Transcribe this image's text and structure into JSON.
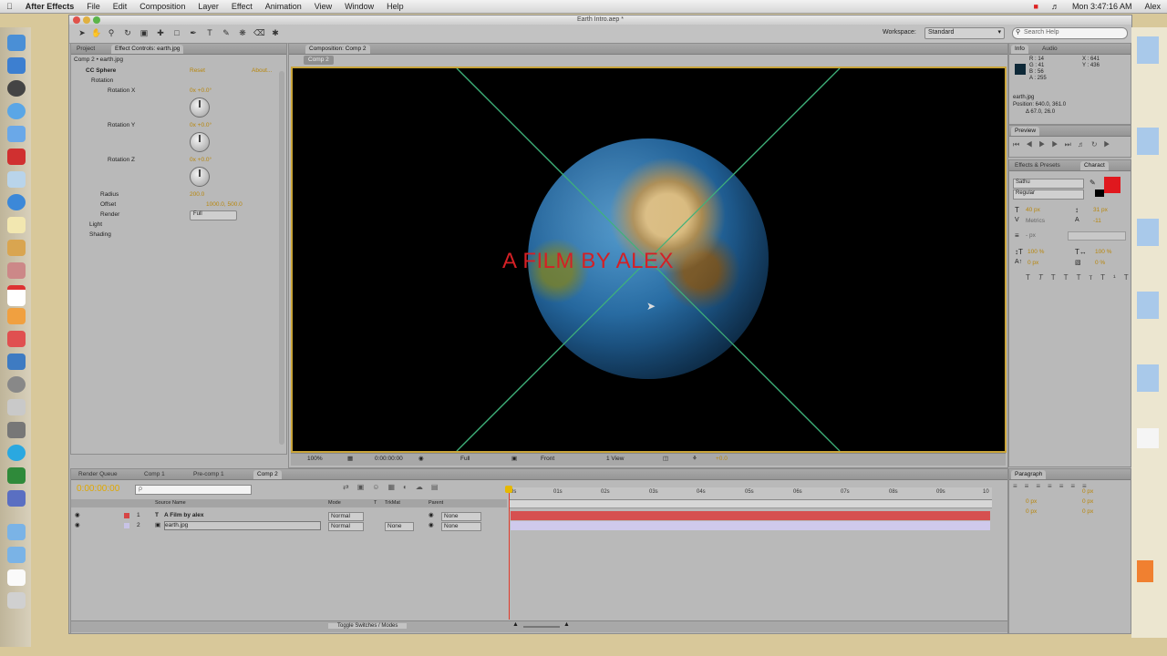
{
  "menubar": {
    "apple": "",
    "app_name": "After Effects",
    "items": [
      "File",
      "Edit",
      "Composition",
      "Layer",
      "Effect",
      "Animation",
      "View",
      "Window",
      "Help"
    ],
    "clock": "Mon 3:47:16 AM",
    "user": "Alex"
  },
  "window": {
    "title": "Earth Intro.aep *"
  },
  "toolbar": {
    "workspace_label": "Workspace:",
    "workspace_value": "Standard",
    "search_placeholder": "Search Help"
  },
  "left_panel": {
    "tabs": [
      "Project",
      "Effect Controls: earth.jpg"
    ],
    "breadcrumb": "Comp 2 • earth.jpg",
    "effect_name": "CC Sphere",
    "reset_label": "Reset",
    "about_label": "About...",
    "props": [
      {
        "label": "Rotation",
        "value": ""
      },
      {
        "label": "Rotation X",
        "value": "0x +0.0°"
      },
      {
        "label": "Rotation Y",
        "value": "0x +0.0°"
      },
      {
        "label": "Rotation Z",
        "value": "0x +0.0°"
      },
      {
        "label": "Radius",
        "value": "200.0"
      },
      {
        "label": "Offset",
        "value": "1000.0, 500.0"
      },
      {
        "label": "Render",
        "value": "Full"
      },
      {
        "label": "Light",
        "value": ""
      },
      {
        "label": "Shading",
        "value": ""
      }
    ]
  },
  "comp_panel": {
    "tab_label": "Composition: Comp 2",
    "sub_tab": "Comp 2",
    "overlay_text": "A FILM BY ALEX",
    "zoom": "100%",
    "timecode": "0:00:00:00",
    "resolution": "Full",
    "view": "Front",
    "views_count": "1 View",
    "exposure": "+0.0"
  },
  "info_panel": {
    "tabs": [
      "Info",
      "Audio"
    ],
    "r": "R : 14",
    "g": "G : 41",
    "b": "B : 56",
    "a": "A : 255",
    "x": "X : 641",
    "y": "Y : 436",
    "layer": "earth.jpg",
    "position": "Position: 640.0, 361.0",
    "delta": "Δ 67.0, 26.0",
    "swatch_color": "#0e2938"
  },
  "preview_panel": {
    "title": "Preview"
  },
  "character_panel": {
    "tabs": [
      "Effects & Presets",
      "Charact"
    ],
    "font": "Sathu",
    "style": "Regular",
    "size": "40 px",
    "leading": "31 px",
    "kerning": "Metrics",
    "tracking": "-11",
    "stroke": "- px",
    "v_scale": "100 %",
    "h_scale": "100 %",
    "baseline": "0 px",
    "tsume": "0 %",
    "fill_color": "#e0181e"
  },
  "timeline": {
    "tabs": [
      "Render Queue",
      "Comp 1",
      "Pre-comp 1",
      "Comp 2"
    ],
    "current_time": "0:00:00:00",
    "search_placeholder": "ρ",
    "columns": [
      "Source Name",
      "Mode",
      "T",
      "TrkMat",
      "Parent"
    ],
    "layers": [
      {
        "num": "1",
        "name": "A Film by alex",
        "mode": "Normal",
        "trkmat": "",
        "parent": "None",
        "color": "#d64545"
      },
      {
        "num": "2",
        "name": "earth.jpg",
        "mode": "Normal",
        "trkmat": "None",
        "parent": "None",
        "color": "#c8c3e6"
      }
    ],
    "ruler": [
      "0s",
      "01s",
      "02s",
      "03s",
      "04s",
      "05s",
      "06s",
      "07s",
      "08s",
      "09s",
      "10"
    ],
    "toggle_label": "Toggle Switches / Modes"
  },
  "paragraph_panel": {
    "title": "Paragraph",
    "indent_left": "0 px",
    "indent_right": "0 px",
    "space_before": "0 px",
    "space_after": "0 px",
    "first_line": "0 px"
  }
}
